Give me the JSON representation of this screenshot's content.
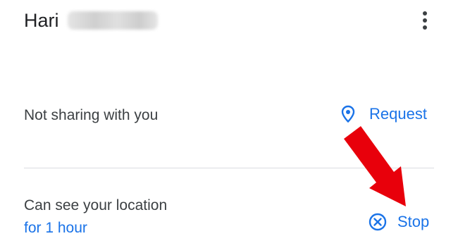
{
  "contact": {
    "first_name": "Hari",
    "surname_state": "blurred"
  },
  "header": {
    "more_icon": "more-vert-icon"
  },
  "incoming": {
    "status_text": "Not sharing with you",
    "action_label": "Request",
    "action_icon": "location-pin-icon"
  },
  "outgoing": {
    "status_text": "Can see your location",
    "duration_text": "for 1 hour",
    "action_label": "Stop",
    "action_icon": "cancel-circle-icon"
  },
  "annotation": {
    "type": "red-arrow",
    "color": "#e8000b",
    "points_to": "stop-button"
  },
  "colors": {
    "accent": "#1a73e8",
    "text": "#3c4043",
    "arrow": "#e8000b"
  }
}
